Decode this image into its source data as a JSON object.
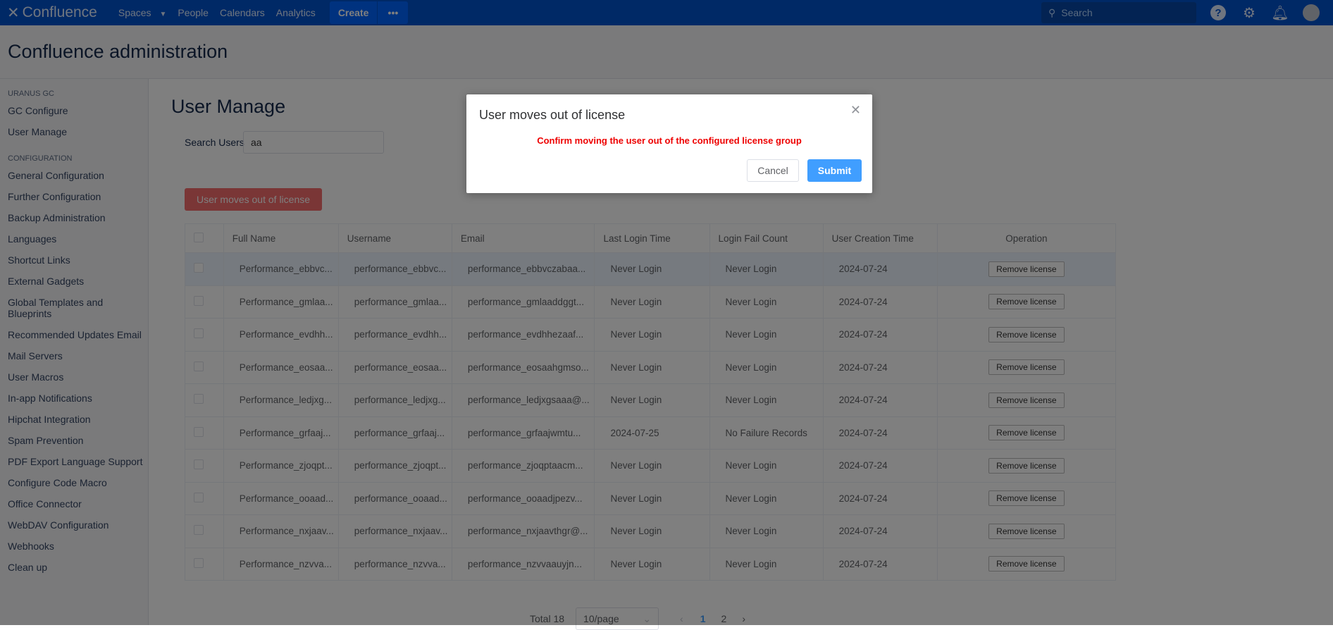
{
  "topbar": {
    "logo": "Confluence",
    "nav": [
      "Spaces",
      "People",
      "Calendars",
      "Analytics"
    ],
    "create": "Create",
    "more": "•••",
    "search_placeholder": "Search"
  },
  "header": {
    "title": "Confluence administration"
  },
  "sidebar": {
    "sections": [
      {
        "title": "URANUS GC",
        "items": [
          "GC Configure",
          "User Manage"
        ]
      },
      {
        "title": "CONFIGURATION",
        "items": [
          "General Configuration",
          "Further Configuration",
          "Backup Administration",
          "Languages",
          "Shortcut Links",
          "External Gadgets",
          "Global Templates and Blueprints",
          "Recommended Updates Email",
          "Mail Servers",
          "User Macros",
          "In-app Notifications",
          "Hipchat Integration",
          "Spam Prevention",
          "PDF Export Language Support",
          "Configure Code Macro",
          "Office Connector",
          "WebDAV Configuration",
          "Webhooks",
          "Clean up"
        ]
      }
    ]
  },
  "main": {
    "title": "User Manage",
    "search_label": "Search Users",
    "search_value": "aa",
    "bulk_button": "User moves out of license",
    "columns": [
      "Full Name",
      "Username",
      "Email",
      "Last Login Time",
      "Login Fail Count",
      "User Creation Time",
      "Operation"
    ],
    "rows": [
      [
        "Performance_ebbvc...",
        "performance_ebbvc...",
        "performance_ebbvczabaa...",
        "Never Login",
        "Never Login",
        "2024-07-24",
        "Remove license"
      ],
      [
        "Performance_gmlaa...",
        "performance_gmlaa...",
        "performance_gmlaaddggt...",
        "Never Login",
        "Never Login",
        "2024-07-24",
        "Remove license"
      ],
      [
        "Performance_evdhh...",
        "performance_evdhh...",
        "performance_evdhhezaaf...",
        "Never Login",
        "Never Login",
        "2024-07-24",
        "Remove license"
      ],
      [
        "Performance_eosaa...",
        "performance_eosaa...",
        "performance_eosaahgmso...",
        "Never Login",
        "Never Login",
        "2024-07-24",
        "Remove license"
      ],
      [
        "Performance_ledjxg...",
        "performance_ledjxg...",
        "performance_ledjxgsaaa@...",
        "Never Login",
        "Never Login",
        "2024-07-24",
        "Remove license"
      ],
      [
        "Performance_grfaaj...",
        "performance_grfaaj...",
        "performance_grfaajwmtu...",
        "2024-07-25",
        "No Failure Records",
        "2024-07-24",
        "Remove license"
      ],
      [
        "Performance_zjoqpt...",
        "performance_zjoqpt...",
        "performance_zjoqptaacm...",
        "Never Login",
        "Never Login",
        "2024-07-24",
        "Remove license"
      ],
      [
        "Performance_ooaad...",
        "performance_ooaad...",
        "performance_ooaadjpezv...",
        "Never Login",
        "Never Login",
        "2024-07-24",
        "Remove license"
      ],
      [
        "Performance_nxjaav...",
        "performance_nxjaav...",
        "performance_nxjaavthgr@...",
        "Never Login",
        "Never Login",
        "2024-07-24",
        "Remove license"
      ],
      [
        "Performance_nzvva...",
        "performance_nzvva...",
        "performance_nzvvaauyjn...",
        "Never Login",
        "Never Login",
        "2024-07-24",
        "Remove license"
      ]
    ],
    "pagination": {
      "total": "Total 18",
      "page_size": "10/page",
      "pages": [
        "1",
        "2"
      ],
      "current": "1"
    }
  },
  "modal": {
    "title": "User moves out of license",
    "message": "Confirm moving the user out of the configured license group",
    "cancel": "Cancel",
    "submit": "Submit"
  }
}
